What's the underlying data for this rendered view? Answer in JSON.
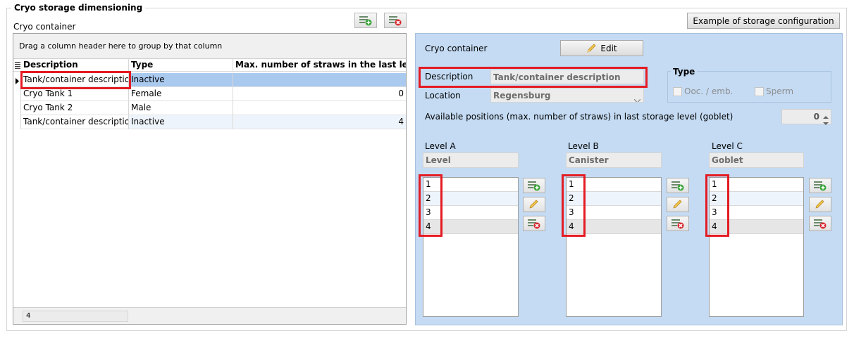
{
  "group": {
    "title": "Cryo storage dimensioning"
  },
  "left": {
    "container_label": "Cryo container"
  },
  "toolbar": {
    "add_icon": "add-row-icon",
    "delete_icon": "delete-row-icon"
  },
  "example_button": {
    "label": "Example of storage configuration"
  },
  "grid": {
    "group_hint": "Drag a column header here to group by that column",
    "columns": [
      "Description",
      "Type",
      "Max. number of straws in the last level"
    ],
    "rows": [
      {
        "description": "Tank/container description",
        "type": "Inactive",
        "max": ""
      },
      {
        "description": "Cryo Tank 1",
        "type": "Female",
        "max": "0"
      },
      {
        "description": "Cryo Tank 2",
        "type": "Male",
        "max": ""
      },
      {
        "description": "Tank/container description",
        "type": "Inactive",
        "max": "4"
      }
    ],
    "footer_count": "4"
  },
  "panel": {
    "cryo_container_label": "Cryo container",
    "edit_label": "Edit",
    "description_label": "Description",
    "description_value": "Tank/container description",
    "location_label": "Location",
    "location_value": "Regensburg",
    "type_title": "Type",
    "type_options": [
      "Ooc. / emb.",
      "Sperm"
    ],
    "positions_label": "Available positions (max. number of straws) in last storage level (goblet)",
    "positions_value": "0"
  },
  "levels": [
    {
      "title": "Level A",
      "name": "Level",
      "items": [
        "1",
        "2",
        "3",
        "4"
      ]
    },
    {
      "title": "Level B",
      "name": "Canister",
      "items": [
        "1",
        "2",
        "3",
        "4"
      ]
    },
    {
      "title": "Level C",
      "name": "Goblet",
      "items": [
        "1",
        "2",
        "3",
        "4"
      ]
    }
  ],
  "colors": {
    "panel_bg": "#c4dbf3",
    "highlight": "#e41b22",
    "selected_row": "#a9c9ef"
  }
}
